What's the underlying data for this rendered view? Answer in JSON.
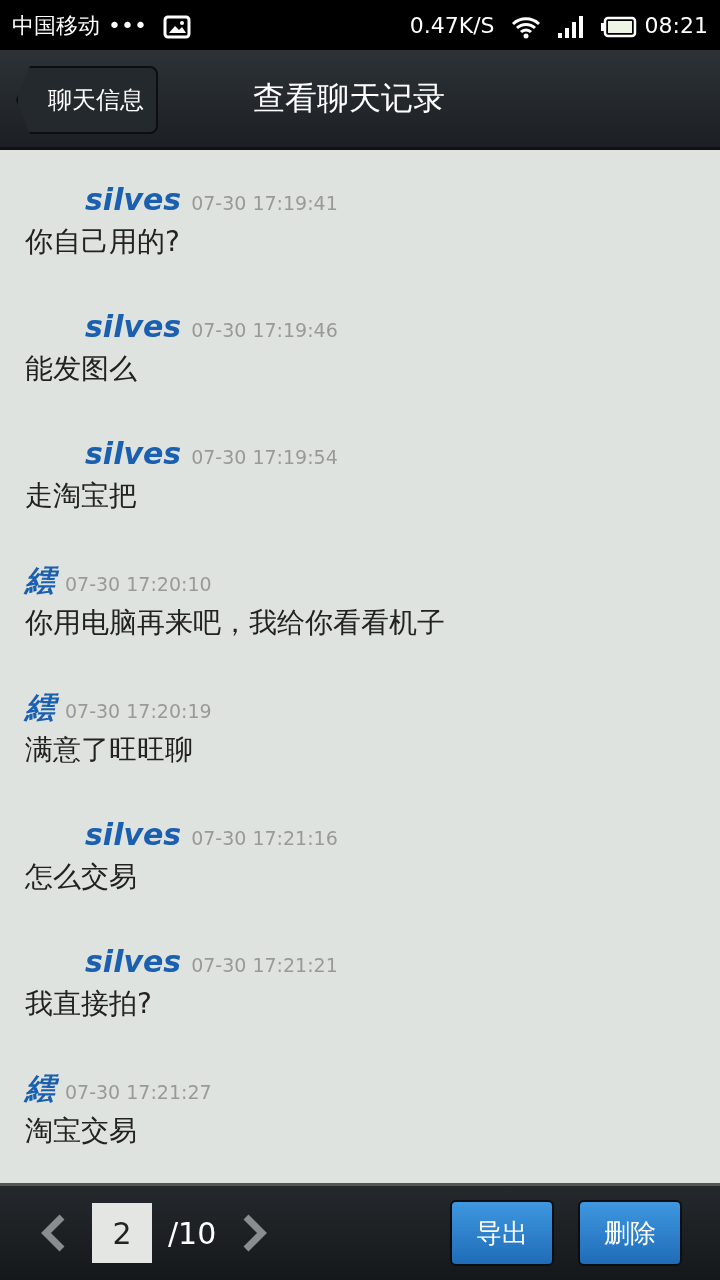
{
  "status_bar": {
    "carrier": "中国移动",
    "dots": "•••",
    "speed": "0.47K/S",
    "time": "08:21"
  },
  "nav": {
    "back": "聊天信息",
    "title": "查看聊天记录"
  },
  "messages": [
    {
      "kind": "indented",
      "sender": "silves",
      "time": "07-30 17:19:41",
      "text": "你自己用的?"
    },
    {
      "kind": "indented",
      "sender": "silves",
      "time": "07-30 17:19:46",
      "text": "能发图么"
    },
    {
      "kind": "indented",
      "sender": "silves",
      "time": "07-30 17:19:54",
      "text": "走淘宝把"
    },
    {
      "kind": "plain",
      "sender": "繧",
      "time": "07-30 17:20:10",
      "text": "你用电脑再来吧，我给你看看机子"
    },
    {
      "kind": "plain",
      "sender": "繧",
      "time": "07-30 17:20:19",
      "text": "满意了旺旺聊"
    },
    {
      "kind": "indented",
      "sender": "silves",
      "time": "07-30 17:21:16",
      "text": "怎么交易"
    },
    {
      "kind": "indented",
      "sender": "silves",
      "time": "07-30 17:21:21",
      "text": "我直接拍?"
    },
    {
      "kind": "plain",
      "sender": "繧",
      "time": "07-30 17:21:27",
      "text": "淘宝交易"
    }
  ],
  "pager": {
    "page": "2",
    "total": "/10"
  },
  "buttons": [
    "导出",
    "删除"
  ]
}
